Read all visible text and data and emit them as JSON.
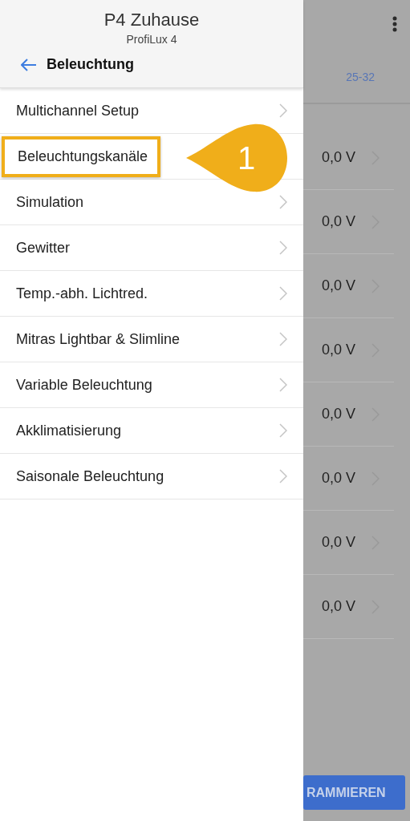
{
  "background_screen": {
    "tab": "25-32",
    "rows": [
      {
        "value": "0,0 V"
      },
      {
        "value": "0,0 V"
      },
      {
        "value": "0,0 V"
      },
      {
        "value": "0,0 V"
      },
      {
        "value": "0,0 V"
      },
      {
        "value": "0,0 V"
      },
      {
        "value": "0,0 V"
      },
      {
        "value": "0,0 V"
      }
    ],
    "button": "RAMMIEREN"
  },
  "drawer": {
    "title": "P4 Zuhause",
    "subtitle": "ProfiLux 4",
    "section": "Beleuchtung",
    "items": [
      {
        "label": "Multichannel Setup",
        "highlighted": false
      },
      {
        "label": "Beleuchtungskanäle",
        "highlighted": true
      },
      {
        "label": "Simulation",
        "highlighted": false
      },
      {
        "label": "Gewitter",
        "highlighted": false
      },
      {
        "label": "Temp.-abh. Lichtred.",
        "highlighted": false
      },
      {
        "label": "Mitras Lightbar & Slimline",
        "highlighted": false
      },
      {
        "label": "Variable Beleuchtung",
        "highlighted": false
      },
      {
        "label": "Akklimatisierung",
        "highlighted": false
      },
      {
        "label": "Saisonale Beleuchtung",
        "highlighted": false
      }
    ]
  },
  "callout": {
    "label": "1"
  }
}
